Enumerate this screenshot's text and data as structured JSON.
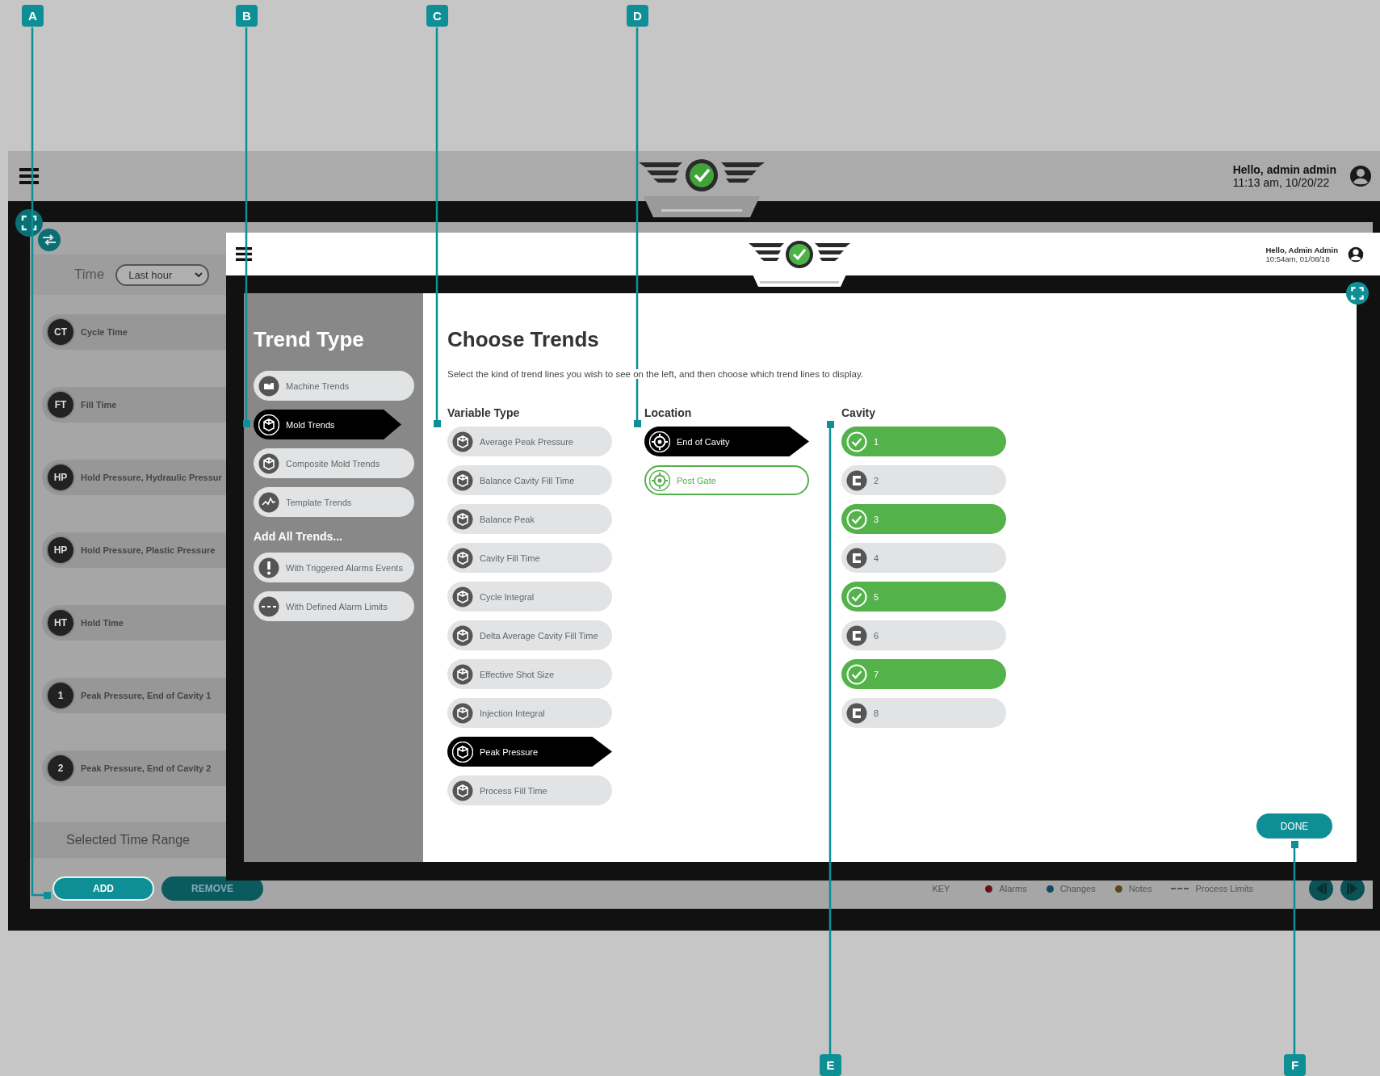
{
  "callouts": [
    {
      "label": "A"
    },
    {
      "label": "B"
    },
    {
      "label": "C"
    },
    {
      "label": "D"
    },
    {
      "label": "E"
    },
    {
      "label": "F"
    }
  ],
  "app": {
    "greeting": "Hello, admin admin",
    "datetime": "11:13 am, 10/20/22",
    "time_filter": {
      "label": "Time",
      "value": "Last hour"
    },
    "trends": [
      {
        "badge": "CT",
        "name": "Cycle Time"
      },
      {
        "badge": "FT",
        "name": "Fill Time"
      },
      {
        "badge": "HP",
        "name": "Hold Pressure, Hydraulic Pressur"
      },
      {
        "badge": "HP",
        "name": "Hold Pressure, Plastic Pressure"
      },
      {
        "badge": "HT",
        "name": "Hold Time"
      },
      {
        "badge": "1",
        "name": "Peak Pressure, End of Cavity 1"
      },
      {
        "badge": "2",
        "name": "Peak Pressure, End of Cavity 2"
      }
    ],
    "range_title": "Selected Time Range",
    "add_button": "ADD",
    "remove_button": "REMOVE",
    "legend": {
      "title": "KEY",
      "items": [
        {
          "kind": "dot",
          "label": "Alarms",
          "color": "#6b1010"
        },
        {
          "kind": "dot",
          "label": "Changes",
          "color": "#0d4a66"
        },
        {
          "kind": "dot",
          "label": "Notes",
          "color": "#5a4a10"
        },
        {
          "kind": "dashes",
          "label": "Process Limits"
        }
      ]
    }
  },
  "modal": {
    "greeting": "Hello, Admin Admin",
    "datetime": "10:54am, 01/08/18",
    "trend_type": {
      "title": "Trend Type",
      "items": [
        {
          "label": "Machine Trends",
          "kind": "machine",
          "selected": false
        },
        {
          "label": "Mold Trends",
          "kind": "mold",
          "selected": true
        },
        {
          "label": "Composite Mold Trends",
          "kind": "mold",
          "selected": false
        },
        {
          "label": "Template Trends",
          "kind": "template",
          "selected": false
        }
      ]
    },
    "add_all": {
      "title": "Add All Trends...",
      "items": [
        {
          "label": "With Triggered Alarms Events",
          "kind": "alarm"
        },
        {
          "label": "With Defined Alarm Limits",
          "kind": "limits"
        }
      ]
    },
    "title": "Choose Trends",
    "instruction": "Select the kind of trend lines you wish to see on the left, and then choose which trend lines to display.",
    "variable_type": {
      "heading": "Variable Type",
      "items": [
        {
          "label": "Average Peak Pressure",
          "selected": false
        },
        {
          "label": "Balance Cavity Fill Time",
          "selected": false
        },
        {
          "label": "Balance Peak",
          "selected": false
        },
        {
          "label": "Cavity Fill Time",
          "selected": false
        },
        {
          "label": "Cycle Integral",
          "selected": false
        },
        {
          "label": "Delta Average Cavity Fill Time",
          "selected": false
        },
        {
          "label": "Effective Shot Size",
          "selected": false
        },
        {
          "label": "Injection Integral",
          "selected": false
        },
        {
          "label": "Peak Pressure",
          "selected": true
        },
        {
          "label": "Process Fill Time",
          "selected": false
        }
      ]
    },
    "location": {
      "heading": "Location",
      "items": [
        {
          "label": "End of Cavity",
          "selected": true,
          "checked": false
        },
        {
          "label": "Post Gate",
          "selected": false,
          "checked": true
        }
      ]
    },
    "cavity": {
      "heading": "Cavity",
      "items": [
        {
          "label": "1",
          "checked": true
        },
        {
          "label": "2",
          "checked": false
        },
        {
          "label": "3",
          "checked": true
        },
        {
          "label": "4",
          "checked": false
        },
        {
          "label": "5",
          "checked": true
        },
        {
          "label": "6",
          "checked": false
        },
        {
          "label": "7",
          "checked": true
        },
        {
          "label": "8",
          "checked": false
        }
      ]
    },
    "done_button": "DONE"
  }
}
